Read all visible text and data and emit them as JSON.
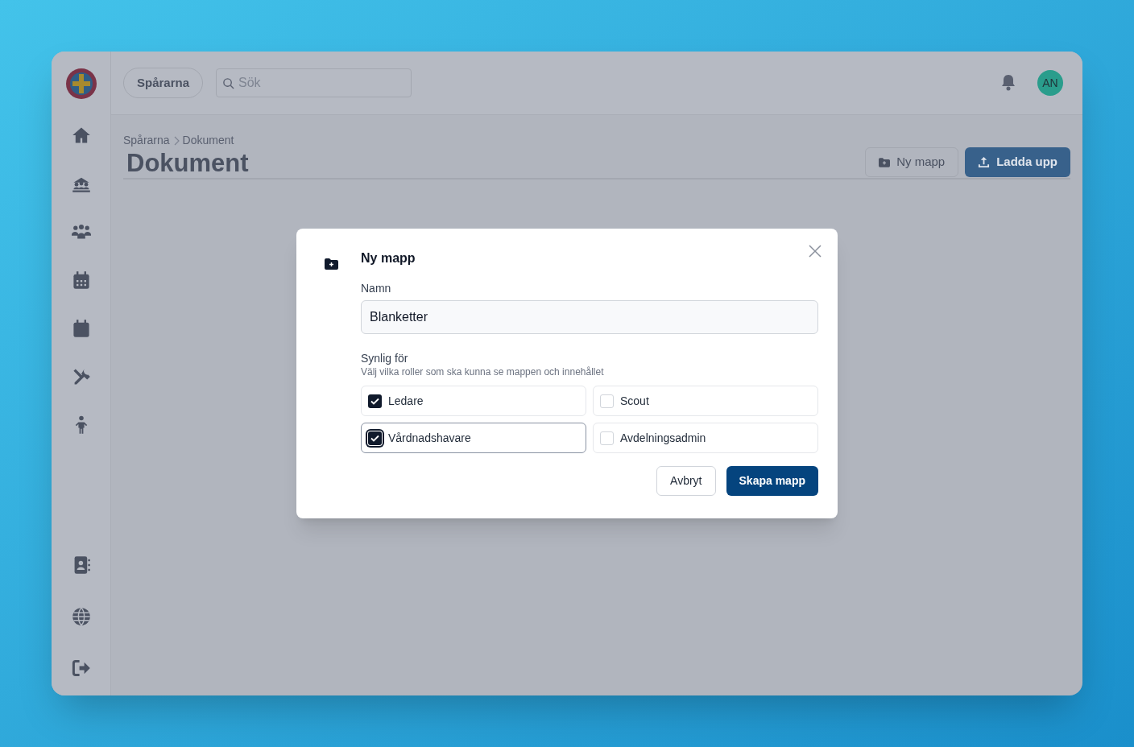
{
  "header": {
    "org_button": "Spårarna",
    "search": {
      "placeholder": "Sök"
    },
    "avatar": "AN"
  },
  "breadcrumb": [
    "Spårarna",
    "Dokument"
  ],
  "page_title": "Dokument",
  "actions": [
    {
      "label": "Ny mapp",
      "kind": "secondary"
    },
    {
      "label": "Ladda upp",
      "kind": "primary"
    }
  ],
  "dialog": {
    "title": "Ny mapp",
    "name_label": "Namn",
    "name_value": "Blanketter",
    "visibility_label": "Synlig för",
    "visibility_hint": "Välj vilka roller som ska kunna se mappen och innehållet",
    "roles": [
      {
        "label": "Ledare",
        "checked": true,
        "focused": false
      },
      {
        "label": "Scout",
        "checked": false,
        "focused": false
      },
      {
        "label": "Vårdnadshavare",
        "checked": true,
        "focused": true
      },
      {
        "label": "Avdelningsadmin",
        "checked": false,
        "focused": false
      }
    ],
    "buttons": [
      {
        "label": "Avbryt",
        "kind": "secondary"
      },
      {
        "label": "Skapa mapp",
        "kind": "primary"
      }
    ]
  }
}
